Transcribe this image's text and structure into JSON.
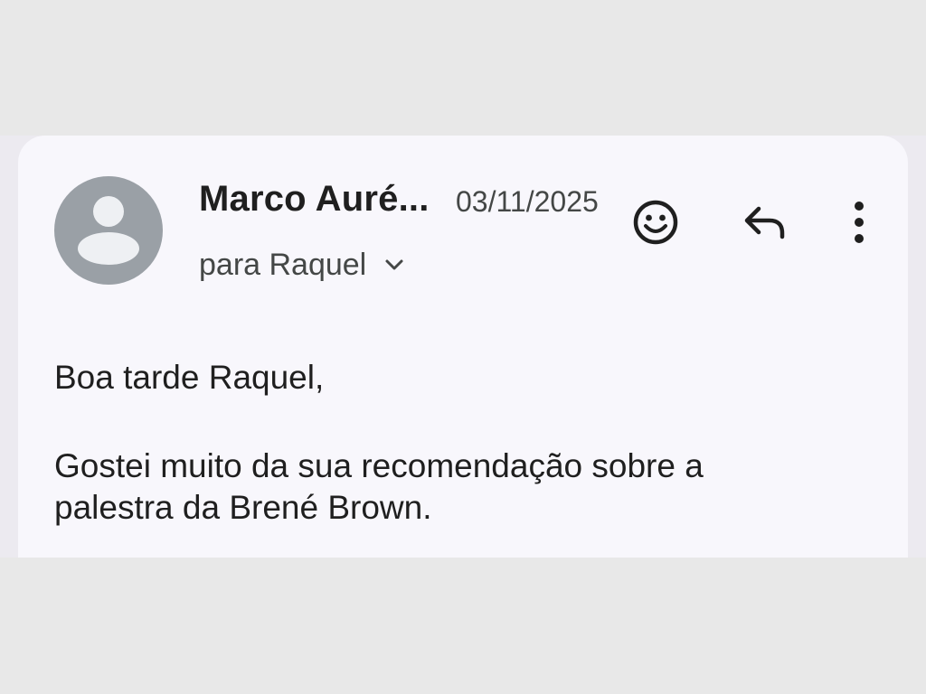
{
  "email": {
    "sender_name": "Marco Auré...",
    "date": "03/11/2025",
    "recipient_line": "para Raquel",
    "body": {
      "greeting": "Boa tarde Raquel,",
      "paragraph_line_1": "Gostei muito da sua recomendação sobre a",
      "paragraph_line_2": "palestra da Brené Brown."
    }
  },
  "icons": {
    "avatar": "person-icon",
    "recipient_toggle": "chevron-down-icon",
    "emoji": "emoji-smile-icon",
    "reply": "reply-icon",
    "more": "more-vert-icon"
  },
  "colors": {
    "page_background": "#e8e8e8",
    "card_background": "#f8f7fc",
    "avatar_background": "#9aa0a6",
    "text_primary": "#1f1f1f",
    "text_secondary": "#444746"
  }
}
